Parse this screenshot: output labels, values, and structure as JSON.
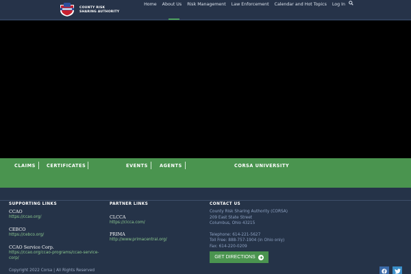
{
  "header": {
    "brand_line1": "COUNTY RISK",
    "brand_line2": "SHARING AUTHORITY",
    "nav": [
      "Home",
      "About Us",
      "Risk Management",
      "Law Enforcement",
      "Calendar and Hot Topics",
      "Log In"
    ],
    "search_icon": "search-icon",
    "colors": {
      "bar": "#263349",
      "active": "#4ea35d"
    }
  },
  "band": {
    "links": [
      "CLAIMS",
      "CERTIFICATES",
      "EVENTS",
      "AGENTS",
      "CORSA UNIVERSITY"
    ],
    "color": "#4a944f"
  },
  "footer": {
    "supporting": {
      "heading": "SUPPORTING LINKS",
      "items": [
        {
          "name": "CCAO",
          "url": "https://ccao.org/"
        },
        {
          "name": "CEBCO",
          "url": "https://cebco.org/"
        },
        {
          "name": "CCAO Service Corp.",
          "url_line1": "https://ccao.org/ccao-programs/ccao-service-",
          "url_line2": "corp/"
        }
      ]
    },
    "partner": {
      "heading": "PARTNER LINKS",
      "items": [
        {
          "name": "CLCCA",
          "url": "https://clcca.com/"
        },
        {
          "name": "PRIMA",
          "url": "http://www.primacentral.org/"
        }
      ]
    },
    "contact": {
      "heading": "CONTACT US",
      "org": "County Risk Sharing Authority (CORSA)",
      "street": "209 East State Street",
      "city": "Columbus, Ohio 43215",
      "telephone": "Telephone: 614-221-5627",
      "tollfree": "Toll Free: 888-757-1904 (in Ohio only)",
      "fax": "Fax: 614-220-0209",
      "directions_label": "GET DIRECTIONS"
    },
    "copyright": "Copyright 2022 Corsa | All Rights Reserved",
    "social": [
      "facebook-icon",
      "twitter-icon"
    ]
  }
}
